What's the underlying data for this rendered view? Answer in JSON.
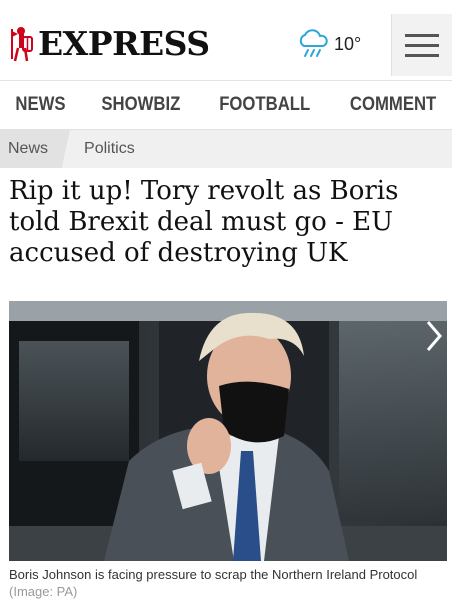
{
  "header": {
    "logo_text": "EXPRESS",
    "weather_icon": "cloud-rain-icon",
    "temperature": "10°",
    "menu_icon": "hamburger-menu-icon"
  },
  "nav": {
    "items": [
      "NEWS",
      "SHOWBIZ",
      "FOOTBALL",
      "COMMENT"
    ]
  },
  "breadcrumb": {
    "items": [
      "News",
      "Politics"
    ]
  },
  "article": {
    "headline": "Rip it up! Tory revolt as Boris told Brexit deal must go - EU accused of destroying UK",
    "image_caption": "Boris Johnson is facing pressure to scrap the Northern Ireland Protocol",
    "image_credit": "(Image: PA)",
    "next_icon": "chevron-right-icon"
  },
  "colors": {
    "brand_red": "#d0021b",
    "text": "#111111",
    "nav_text": "#444444"
  }
}
